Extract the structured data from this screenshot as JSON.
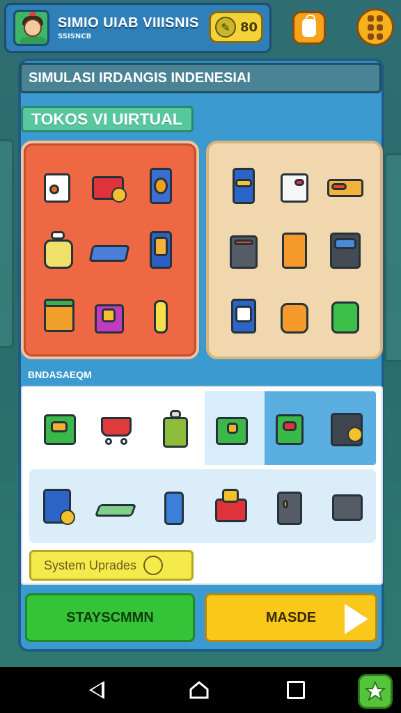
{
  "header": {
    "title": "SIMIO UIAB VIIISNIS",
    "subtitle": "SSISNCB",
    "coins": "80",
    "coin_icon": "leaf-coin-icon",
    "bag_icon": "shopping-bag-icon",
    "menu_icon": "menu-grid-icon"
  },
  "main": {
    "title": "SIMULASI IRDANGIS INDENESIAI",
    "shop_tag": "TOKOS VI UIRTUAL",
    "left_panel_items": [
      "gift-bag",
      "red-box-coin",
      "blue-jar",
      "snack-bag",
      "cereal-box",
      "phone-box",
      "juice-carton",
      "shopping-bag",
      "bottle"
    ],
    "right_panel_items": [
      "blue-can",
      "milk-carton",
      "noodle-box",
      "battery-pack",
      "orange-box",
      "machine-box",
      "soap-box",
      "juice-bag",
      "green-bag"
    ],
    "section_label": "BNDASAEQM",
    "inventory_row1": [
      "green-box",
      "shopping-cart",
      "green-bottle",
      "green-crate",
      "green-pack",
      "safe-box"
    ],
    "inventory_row2": [
      "blue-box-coin",
      "tray",
      "blue-bottle",
      "red-parcel",
      "grey-machine",
      "grey-box"
    ],
    "upgrade_label": "System Uprades",
    "btn_left": "STAYSCMMN",
    "btn_right": "MASDE"
  },
  "colors": {
    "accent_blue": "#3b9ad0",
    "panel_orange": "#ee6844",
    "panel_beige": "#f0d7ad",
    "btn_green": "#35c437",
    "btn_yellow": "#f9c81a"
  }
}
